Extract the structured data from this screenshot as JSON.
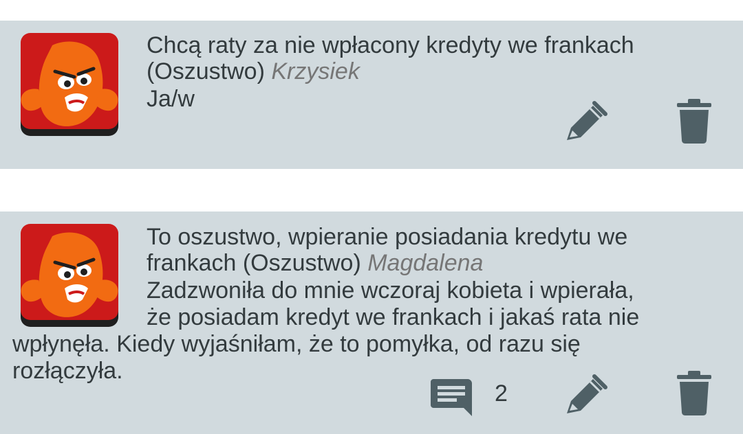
{
  "posts": [
    {
      "title_line1": "Chcą raty za nie wpłacony kredyty we frankach",
      "title_line2": "(Oszustwo)",
      "author": "Krzysiek",
      "body_line1": "Ja/w"
    },
    {
      "title_line1": "To oszustwo, wpieranie posiadania kredytu we",
      "title_line2": "frankach (Oszustwo)",
      "author": "Magdalena",
      "body_line1": "Zadzwoniła do mnie wczoraj kobieta i wpierała,",
      "body_line2": "że posiadam kredyt we frankach i jakaś rata nie",
      "body_line3": "wpłynęła. Kiedy wyjaśniłam, że to pomyłka, od razu się",
      "body_line4": "rozłączyła.",
      "comment_count": "2"
    }
  ],
  "colors": {
    "card_background": "#d1dade",
    "icon": "#4f6066",
    "text": "#333b3e",
    "author": "#767676",
    "avatar_red": "#cc1a1a",
    "avatar_orange": "#f26b12"
  },
  "icons": {
    "avatar": "angry-monster-avatar",
    "edit": "pencil-icon",
    "delete": "trash-icon",
    "comments": "comment-icon"
  }
}
